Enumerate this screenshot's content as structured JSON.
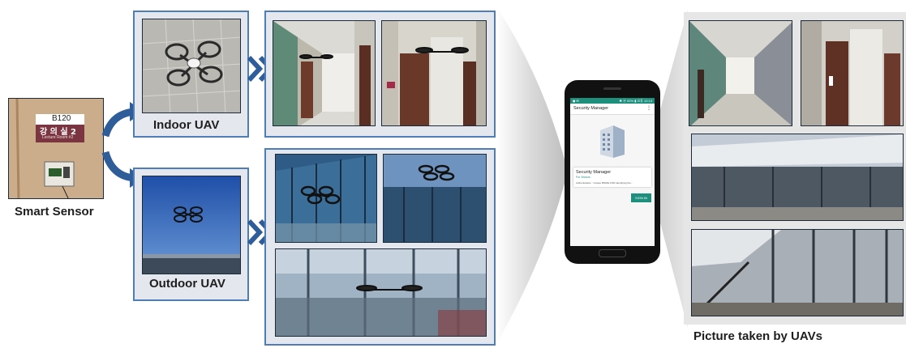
{
  "sensor": {
    "room_number": "B120",
    "room_name_korean": "강 의 실 2",
    "room_name_english": "Lecture Room #2",
    "caption": "Smart Sensor"
  },
  "indoor": {
    "caption": "Indoor UAV"
  },
  "outdoor": {
    "caption": "Outdoor UAV"
  },
  "results": {
    "caption": "Picture taken by UAVs"
  },
  "app": {
    "status_left": "◼ ✉",
    "status_right": "✱ ⓦ 92% ▮ 오후 12:13",
    "title": "Security Manager",
    "menu_icon": "⋮",
    "card_title": "Security Manager",
    "card_subtitle": "For Visitors",
    "card_detail": "Authentication : Unique BODIE FOR identifying the...",
    "signin_label": "SIGN IN"
  },
  "colors": {
    "panel_border": "#4f7db5",
    "panel_fill": "#e4e8ee",
    "arrow_blue": "#2f5d9a",
    "app_accent": "#1e8f7d"
  }
}
